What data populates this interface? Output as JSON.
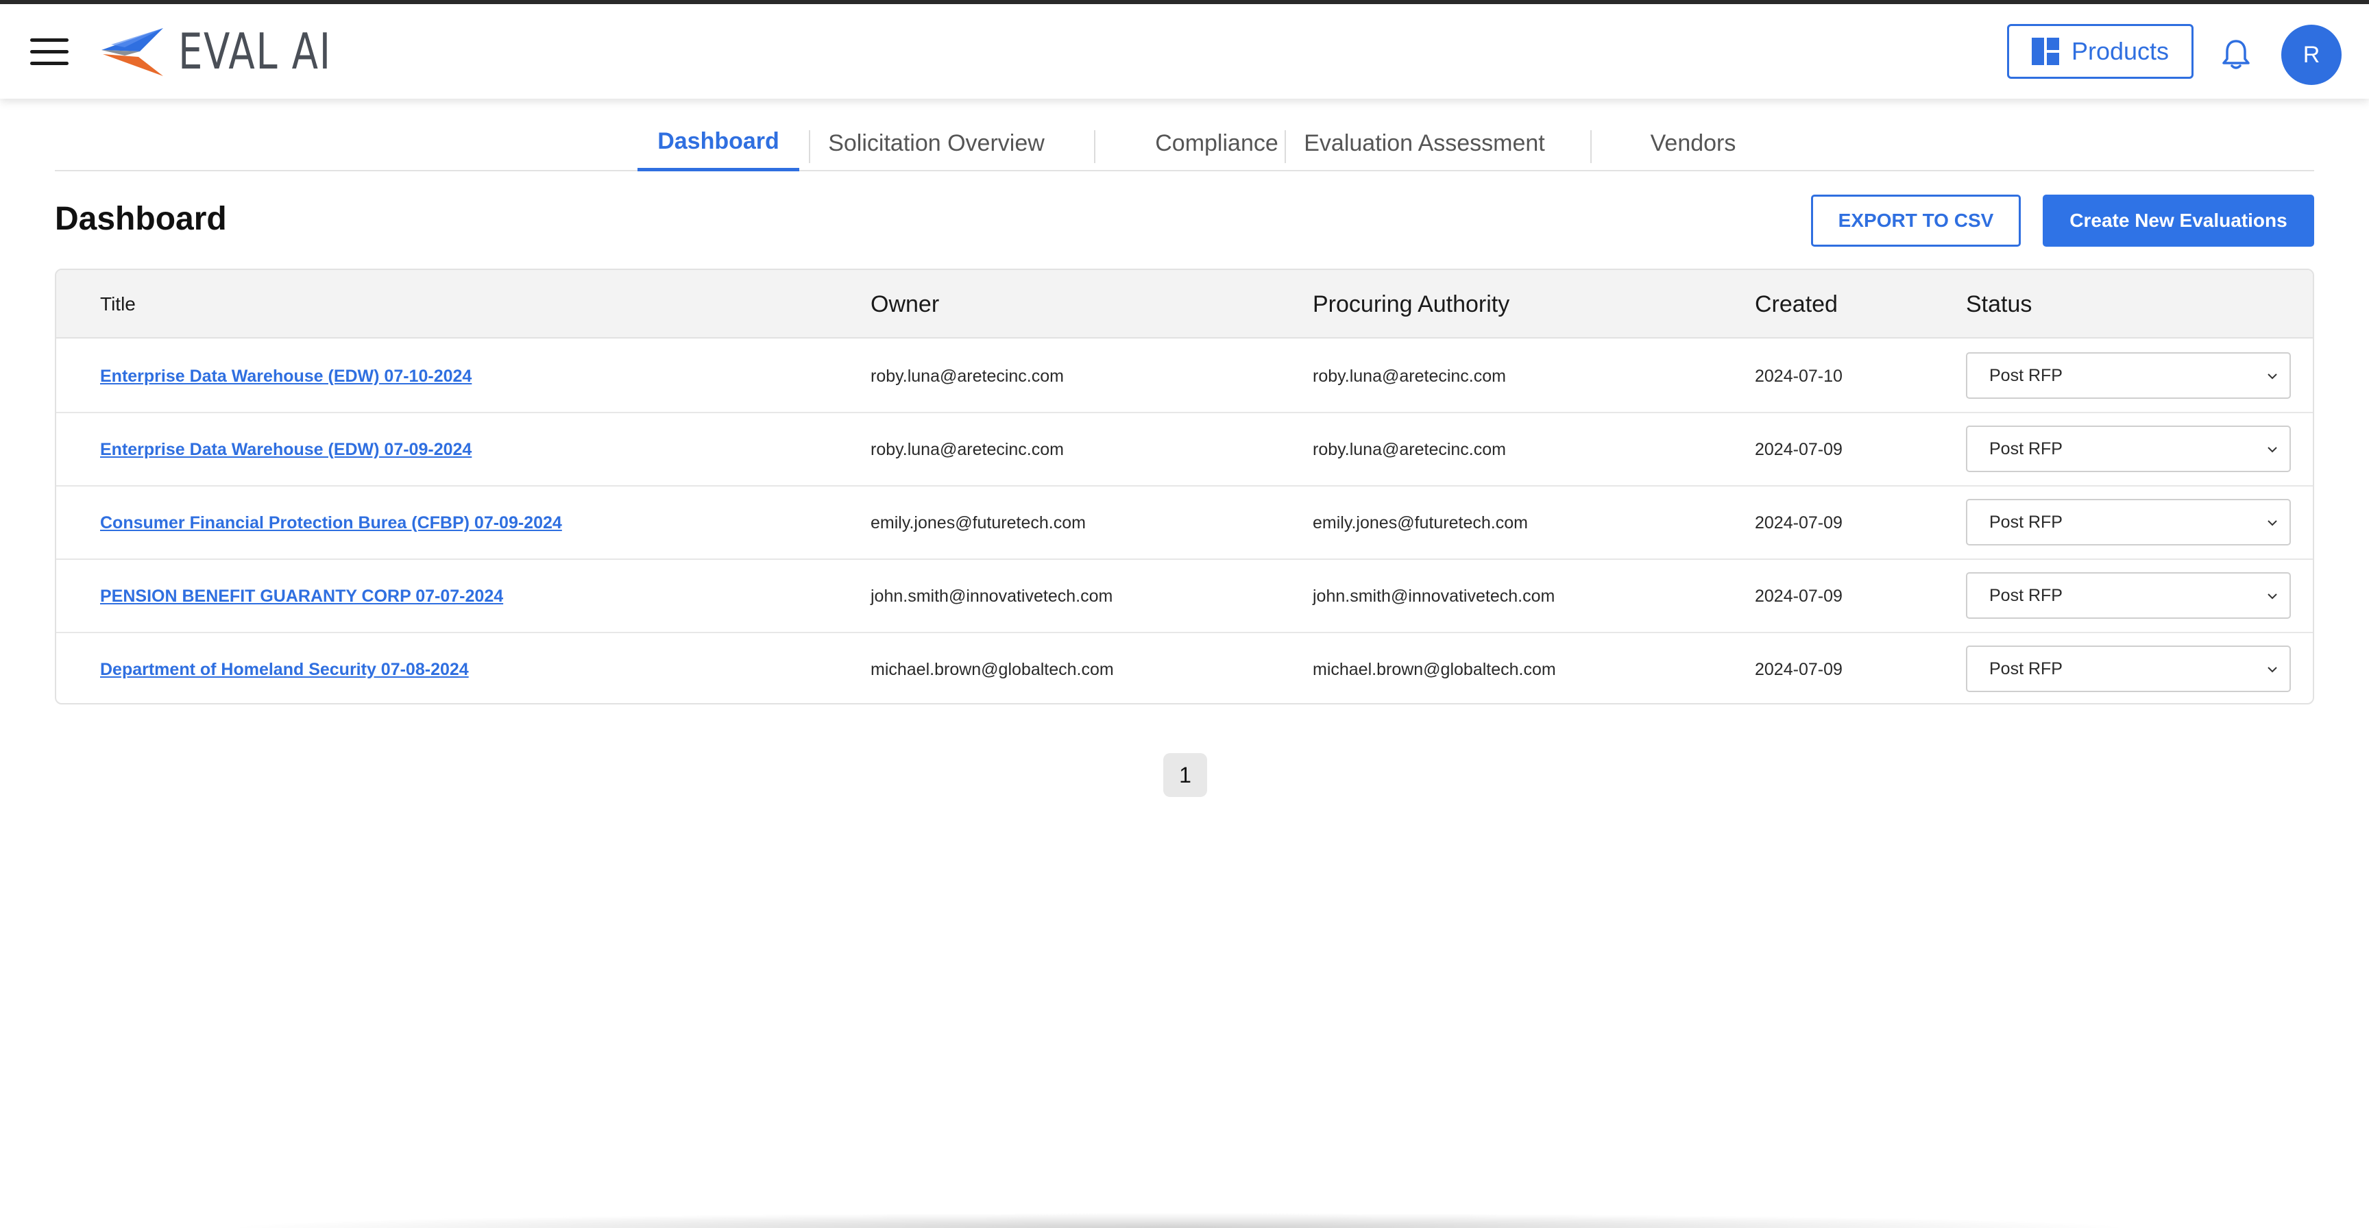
{
  "header": {
    "app_name": "EVAL AI",
    "products_label": "Products",
    "avatar_initial": "R",
    "brand_color": "#2f6fe0"
  },
  "tabs": [
    {
      "label": "Dashboard",
      "active": true
    },
    {
      "label": "Solicitation Overview",
      "active": false
    },
    {
      "label": "Compliance",
      "active": false
    },
    {
      "label": "Evaluation Assessment",
      "active": false
    },
    {
      "label": "Vendors",
      "active": false
    }
  ],
  "page": {
    "title": "Dashboard",
    "export_label": "EXPORT TO CSV",
    "create_label": "Create New Evaluations"
  },
  "table": {
    "columns": [
      "Title",
      "Owner",
      "Procuring Authority",
      "Created",
      "Status"
    ],
    "rows": [
      {
        "title": "Enterprise Data Warehouse (EDW) 07-10-2024",
        "owner": "roby.luna@aretecinc.com",
        "authority": "roby.luna@aretecinc.com",
        "created": "2024-07-10",
        "status": "Post RFP"
      },
      {
        "title": "Enterprise Data Warehouse (EDW) 07-09-2024",
        "owner": "roby.luna@aretecinc.com",
        "authority": "roby.luna@aretecinc.com",
        "created": "2024-07-09",
        "status": "Post RFP"
      },
      {
        "title": "Consumer Financial Protection Burea (CFBP) 07-09-2024",
        "owner": "emily.jones@futuretech.com",
        "authority": "emily.jones@futuretech.com",
        "created": "2024-07-09",
        "status": "Post RFP"
      },
      {
        "title": "PENSION BENEFIT GUARANTY CORP 07-07-2024",
        "owner": "john.smith@innovativetech.com",
        "authority": "john.smith@innovativetech.com",
        "created": "2024-07-09",
        "status": "Post RFP"
      },
      {
        "title": "Department of Homeland Security 07-08-2024",
        "owner": "michael.brown@globaltech.com",
        "authority": "michael.brown@globaltech.com",
        "created": "2024-07-09",
        "status": "Post RFP"
      }
    ]
  },
  "pagination": {
    "current_page": "1"
  },
  "icons": {
    "menu": "hamburger-menu-icon",
    "logo": "eval-ai-logo-icon",
    "products": "grid-icon",
    "notifications": "bell-icon",
    "dropdown": "chevron-down-icon"
  }
}
